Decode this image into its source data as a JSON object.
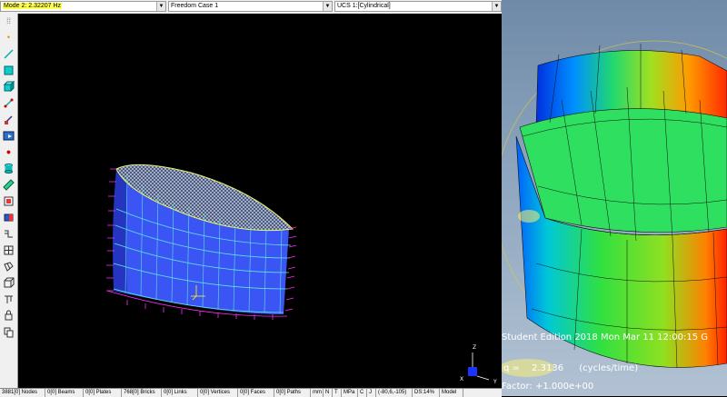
{
  "header": {
    "mode_value": "Mode 2: 2.32207 Hz",
    "case_value": "Freedom Case 1",
    "ucs_value": "UCS 1:[Cylindrical]"
  },
  "toolbar": {
    "icons": [
      "grid-icon",
      "point-icon",
      "line-icon",
      "plate-icon",
      "brick-icon",
      "link-icon",
      "beam-arrow-icon",
      "attribute-icon",
      "node-icon",
      "cylinder-icon",
      "ruler-icon",
      "load-icon",
      "restraint-icon",
      "subdivide-icon",
      "grid-frame-icon",
      "mesh-icon",
      "solid-mesh-icon",
      "tools-icon",
      "node-lock-icon",
      "copy-icon"
    ]
  },
  "viewport": {
    "axis_z": "Z",
    "axis_x": "X",
    "axis_y": "Y"
  },
  "status": {
    "nodes": "3881[0] Nodes",
    "beams": "0[0] Beams",
    "plates": "0[0] Plates",
    "bricks": "768[0] Bricks",
    "links": "0[0] Links",
    "vertices": "0[0] Vertices",
    "faces": "0[0] Faces",
    "paths": "0[0] Paths",
    "unit_length": "mm",
    "unit_force": "N",
    "unit_temp": "T",
    "unit_stress": "MPa",
    "unit_c": "C",
    "unit_j": "J",
    "view_angles": "(-80,6,-105)",
    "ds": "DS:14%",
    "model": "Model"
  },
  "right_panel": {
    "edition_line": "Student Edition 2018    Mon Mar 11 12:00:15 G",
    "freq_label": "q =",
    "freq_value": "2.3136",
    "freq_unit": "(cycles/time)",
    "factor_line": "Factor: +1.000e+00"
  },
  "colors": {
    "highlight": "#ffff4d",
    "mesh_fill": "#3b55f5",
    "wire": "#5fe3e0",
    "restraint": "#ff2bff",
    "top_mesh": "#e6f76a"
  }
}
